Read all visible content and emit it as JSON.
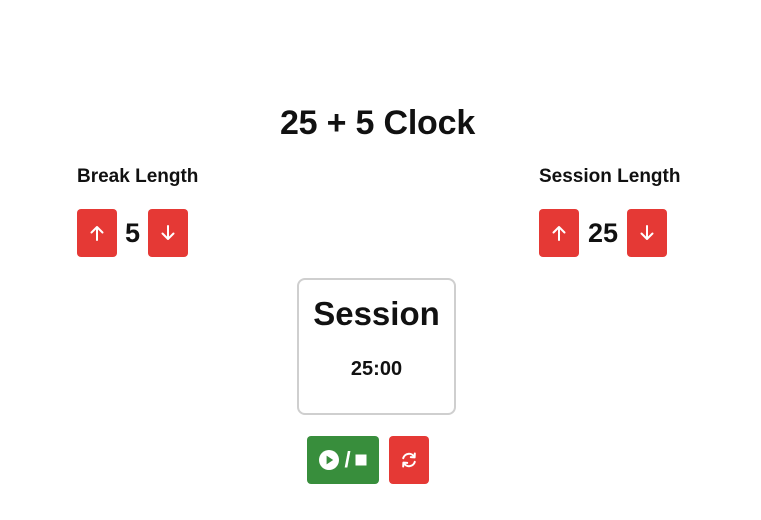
{
  "app": {
    "title": "25 + 5 Clock"
  },
  "break": {
    "label": "Break Length",
    "value": "5",
    "increment_icon": "arrow-up-icon",
    "decrement_icon": "arrow-down-icon"
  },
  "session": {
    "label": "Session Length",
    "value": "25",
    "increment_icon": "arrow-up-icon",
    "decrement_icon": "arrow-down-icon"
  },
  "timer": {
    "label": "Session",
    "time_left": "25:00"
  },
  "controls": {
    "start_stop_icons": [
      "play-circle-icon",
      "stop-icon"
    ],
    "start_stop_separator": "/",
    "reset_icon": "refresh-icon"
  },
  "colors": {
    "button_red": "#e53935",
    "button_green": "#388e3c",
    "timer_border": "#cfcfcf"
  }
}
